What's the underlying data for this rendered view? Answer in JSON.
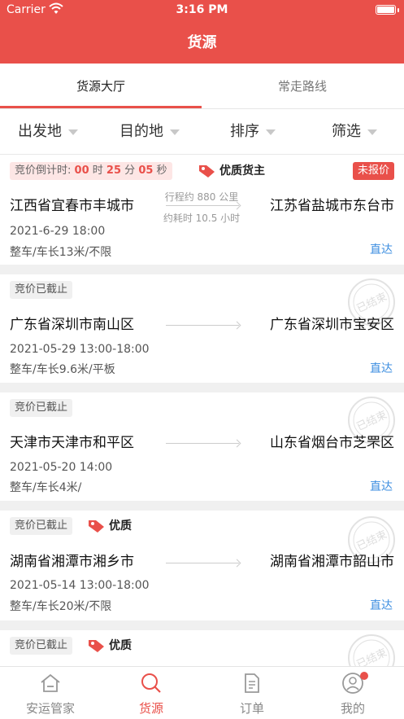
{
  "status_bar": {
    "carrier": "Carrier",
    "time": "3:16 PM"
  },
  "header": {
    "title": "货源"
  },
  "tabs": [
    {
      "label": "货源大厅"
    },
    {
      "label": "常走路线"
    }
  ],
  "filters": [
    {
      "label": "出发地"
    },
    {
      "label": "目的地"
    },
    {
      "label": "排序"
    },
    {
      "label": "筛选"
    }
  ],
  "cards": [
    {
      "status_prefix": "竞价倒计时:",
      "countdown": {
        "h": "00",
        "h_unit": "时",
        "m": "25",
        "m_unit": "分",
        "s": "05",
        "s_unit": "秒"
      },
      "tag": "优质货主",
      "quote_status": "未报价",
      "from": "江西省宜春市丰城市",
      "to": "江苏省盐城市东台市",
      "distance": "行程约 880 公里",
      "duration": "约耗时 10.5 小时",
      "date": "2021-6-29  18:00",
      "spec": "整车/车长13米/不限",
      "route_type": "直达"
    },
    {
      "status": "竞价已截止",
      "from": "广东省深圳市南山区",
      "to": "广东省深圳市宝安区",
      "date": "2021-05-29  13:00-18:00",
      "spec": "整车/车长9.6米/平板",
      "route_type": "直达"
    },
    {
      "status": "竞价已截止",
      "from": "天津市天津市和平区",
      "to": "山东省烟台市芝罘区",
      "date": "2021-05-20  14:00",
      "spec": "整车/车长4米/",
      "route_type": "直达"
    },
    {
      "status": "竞价已截止",
      "tag": "优质",
      "from": "湖南省湘潭市湘乡市",
      "to": "湖南省湘潭市韶山市",
      "date": "2021-05-14  13:00-18:00",
      "spec": "整车/车长20米/不限",
      "route_type": "直达"
    },
    {
      "status": "竞价已截止",
      "tag": "优质"
    }
  ],
  "stamp_text": "已结束",
  "tabbar": [
    {
      "label": "安运管家",
      "icon": "home-icon"
    },
    {
      "label": "货源",
      "icon": "search-icon"
    },
    {
      "label": "订单",
      "icon": "document-icon"
    },
    {
      "label": "我的",
      "icon": "user-icon"
    }
  ],
  "colors": {
    "brand": "#e9504a",
    "link": "#3c8ee0"
  }
}
